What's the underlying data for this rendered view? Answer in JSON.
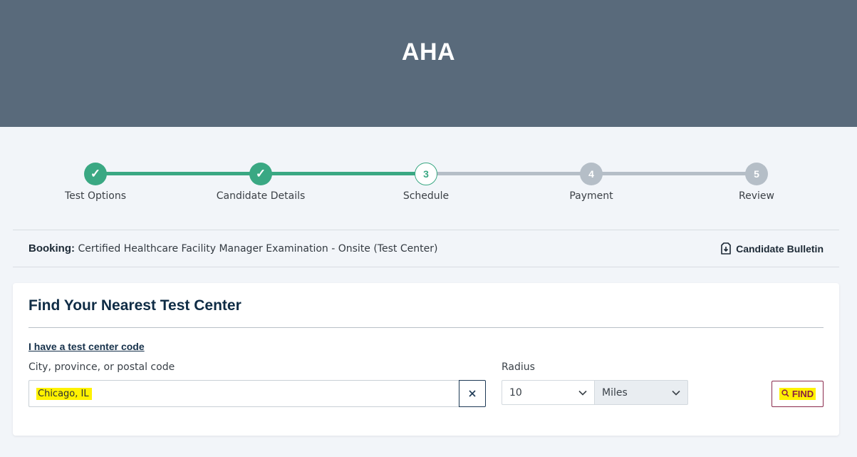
{
  "header": {
    "title": "AHA"
  },
  "stepper": {
    "steps": [
      {
        "label": "Test Options",
        "state": "done",
        "marker": "✓"
      },
      {
        "label": "Candidate Details",
        "state": "done",
        "marker": "✓"
      },
      {
        "label": "Schedule",
        "state": "current",
        "marker": "3"
      },
      {
        "label": "Payment",
        "state": "todo",
        "marker": "4"
      },
      {
        "label": "Review",
        "state": "todo",
        "marker": "5"
      }
    ]
  },
  "booking": {
    "label": "Booking:",
    "value": "Certified Healthcare Facility Manager Examination - Onsite (Test Center)",
    "bulletin_label": "Candidate Bulletin",
    "bulletin_icon": "document-download-icon"
  },
  "finder": {
    "title": "Find Your Nearest Test Center",
    "code_link": "I have a test center code",
    "city_label": "City, province, or postal code",
    "city_value": "Chicago, IL",
    "clear_icon": "close-icon",
    "radius_label": "Radius",
    "radius_value": "10",
    "unit_value": "Miles",
    "find_label": "FIND",
    "find_icon": "search-icon"
  },
  "colors": {
    "header_bg": "#596a7b",
    "done": "#3aa883",
    "todo": "#b5bec7",
    "highlight": "#fff200",
    "find_accent": "#8a1f3f"
  }
}
